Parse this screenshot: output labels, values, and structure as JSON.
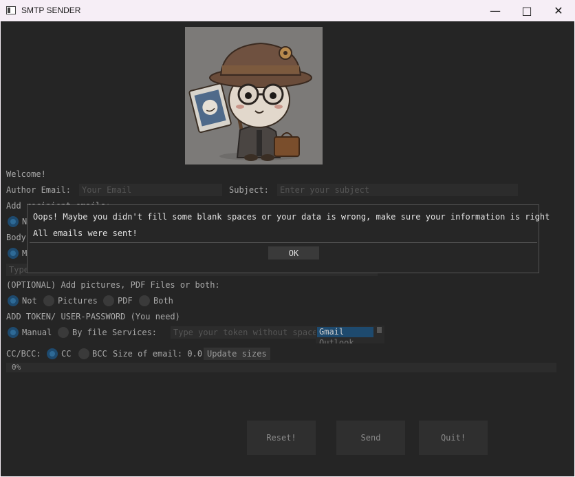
{
  "window": {
    "title": "SMTP SENDER"
  },
  "form": {
    "welcome": "Welcome!",
    "author_label": "Author Email:",
    "author_placeholder": "Your Email",
    "subject_label": "Subject:",
    "subject_placeholder": "Enter your subject",
    "recipients_label": "Add recipient emails:",
    "recipients_option": "N",
    "body_label": "Body",
    "body_option": "M",
    "body_placeholder": "Type",
    "attach_label": "(OPTIONAL) Add pictures, PDF Files or both:",
    "attach_options": [
      "Not",
      "Pictures",
      "PDF",
      "Both"
    ],
    "token_label": "ADD TOKEN/ USER-PASSWORD (You need)",
    "token_options": [
      "Manual",
      "By file"
    ],
    "services_label": "Services:",
    "token_placeholder": "Type your token without spaces",
    "services": [
      "Gmail",
      "Outlook"
    ],
    "cc_label": "CC/BCC:",
    "cc_options": [
      "CC",
      "BCC"
    ],
    "size_text": "Size of email: 0.0",
    "update_sizes": "Update sizes",
    "progress": {
      "text": "0%",
      "value": 0
    }
  },
  "buttons": {
    "reset": "Reset!",
    "send": "Send",
    "quit": "Quit!"
  },
  "dialog": {
    "message": "Oops! Maybe you didn't fill some blank spaces or your data is wrong, make sure your information is right",
    "message2": "All emails were sent!",
    "ok": "OK"
  },
  "colors": {
    "accent": "#1e4a6e",
    "background": "#252525",
    "titlebar": "#f6eef6"
  },
  "icons": [
    "app-icon",
    "minimize-icon",
    "maximize-icon",
    "close-icon",
    "mascot-image"
  ]
}
